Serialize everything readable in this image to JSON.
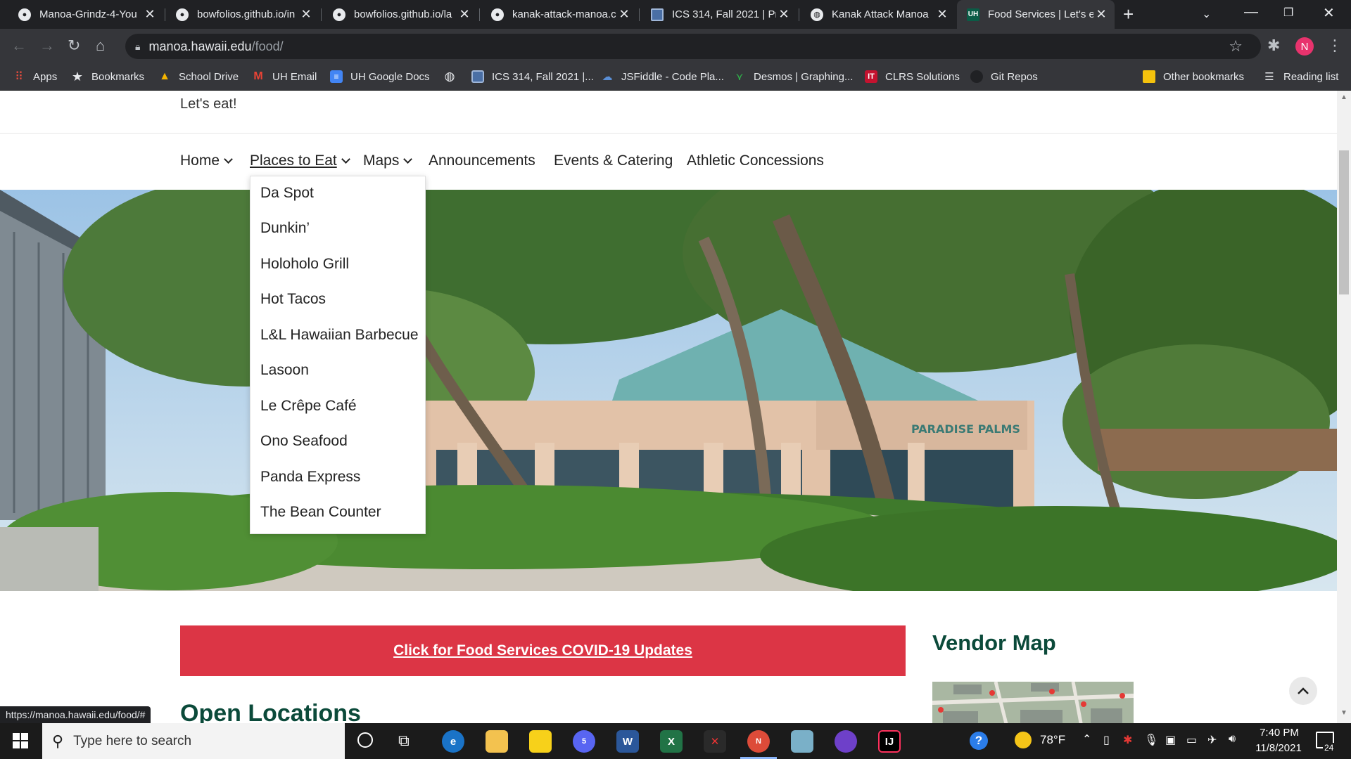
{
  "tabs": [
    {
      "title": "Manoa-Grindz-4-You",
      "icon": "github-icon"
    },
    {
      "title": "bowfolios.github.io/in",
      "icon": "github-icon"
    },
    {
      "title": "bowfolios.github.io/la",
      "icon": "github-icon"
    },
    {
      "title": "kanak-attack-manoa.c",
      "icon": "github-icon"
    },
    {
      "title": "ICS 314, Fall 2021 | Pr",
      "icon": "page-icon"
    },
    {
      "title": "Kanak Attack Manoa",
      "icon": "globe-icon"
    },
    {
      "title": "Food Services | Let's e",
      "icon": "uh-logo-icon",
      "active": true
    }
  ],
  "address": {
    "host": "manoa.hawaii.edu",
    "path": "/food/"
  },
  "profile_initial": "N",
  "bookmarks": [
    "Apps",
    "Bookmarks",
    "School Drive",
    "UH Email",
    "UH Google Docs",
    "",
    "ICS 314, Fall 2021 |...",
    "JSFiddle - Code Pla...",
    "Desmos | Graphing...",
    "CLRS Solutions",
    "Git Repos"
  ],
  "bookmarks_right": [
    "Other bookmarks",
    "Reading list"
  ],
  "page": {
    "tagline": "Let's eat!",
    "nav": [
      "Home",
      "Places to Eat",
      "Maps",
      "Announcements",
      "Events & Catering",
      "Athletic Concessions"
    ],
    "dropdown": [
      "Da Spot",
      "Dunkin’",
      "Holoholo Grill",
      "Hot Tacos",
      "L&L Hawaiian Barbecue",
      "Lasoon",
      "Le Crêpe Café",
      "Ono Seafood",
      "Panda Express",
      "The Bean Counter"
    ],
    "hero_sign": "PARADISE PALMS",
    "covid_banner": "Click for Food Services COVID-19 Updates",
    "vendor_heading": "Vendor Map",
    "open_heading": "Open Locations"
  },
  "status_url": "https://manoa.hawaii.edu/food/#",
  "taskbar": {
    "search_placeholder": "Type here to search",
    "weather": "78°F",
    "time": "7:40 PM",
    "date": "11/8/2021",
    "notification_count": "24",
    "chrome_badge": "N",
    "discord_badge": "5"
  },
  "colors": {
    "covid_red": "#dc3545",
    "heading_green": "#0b4a3a",
    "chrome_dark": "#202124",
    "chrome_toolbar": "#35363a"
  }
}
